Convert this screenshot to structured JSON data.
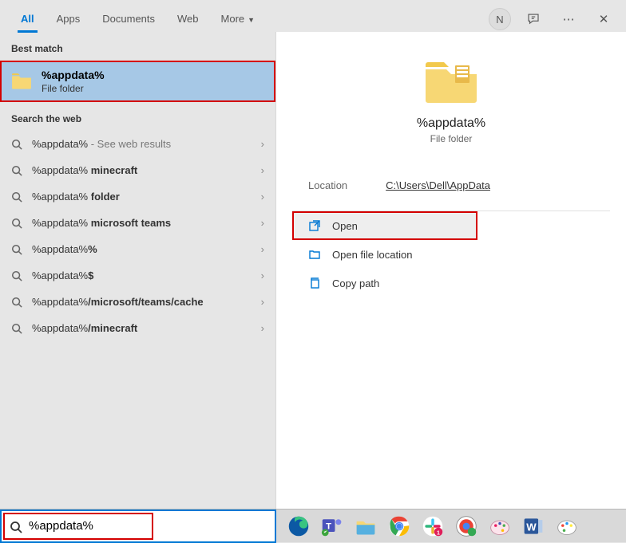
{
  "tabs": {
    "all": "All",
    "apps": "Apps",
    "documents": "Documents",
    "web": "Web",
    "more": "More"
  },
  "user_initial": "N",
  "best_match_header": "Best match",
  "best_match": {
    "title": "%appdata%",
    "subtitle": "File folder"
  },
  "web_header": "Search the web",
  "suggestions": [
    {
      "pre": "%appdata%",
      "post": "",
      "hint": " - See web results"
    },
    {
      "pre": "%appdata%",
      "post": " minecraft",
      "hint": ""
    },
    {
      "pre": "%appdata%",
      "post": " folder",
      "hint": ""
    },
    {
      "pre": "%appdata%",
      "post": " microsoft teams",
      "hint": ""
    },
    {
      "pre": "%appdata%",
      "post": "%",
      "hint": ""
    },
    {
      "pre": "%appdata%",
      "post": "$",
      "hint": ""
    },
    {
      "pre": "%appdata%",
      "post": "/microsoft/teams/cache",
      "hint": ""
    },
    {
      "pre": "%appdata%",
      "post": "/minecraft",
      "hint": ""
    }
  ],
  "preview": {
    "title": "%appdata%",
    "subtitle": "File folder",
    "location_label": "Location",
    "location_value": "C:\\Users\\Dell\\AppData"
  },
  "actions": {
    "open": "Open",
    "open_location": "Open file location",
    "copy_path": "Copy path"
  },
  "search_value": "%appdata%"
}
